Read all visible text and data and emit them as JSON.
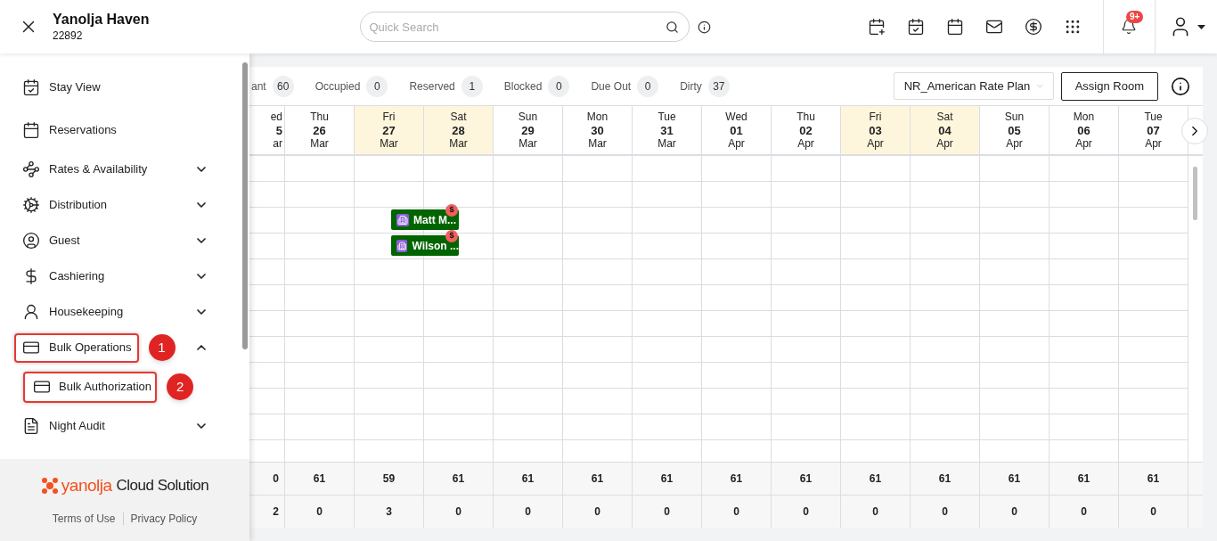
{
  "header": {
    "property_name": "Yanolja Haven",
    "property_id": "22892",
    "search": {
      "placeholder": "Quick Search"
    },
    "notification_badge": "9+"
  },
  "sidebar": {
    "items": [
      {
        "label": "Stay View",
        "kind": "link",
        "highlighted": false
      },
      {
        "label": "Reservations",
        "kind": "link",
        "highlighted": false
      },
      {
        "label": "Rates & Availability",
        "kind": "group",
        "expanded": false,
        "highlighted": false
      },
      {
        "label": "Distribution",
        "kind": "group",
        "expanded": false,
        "highlighted": false
      },
      {
        "label": "Guest",
        "kind": "group",
        "expanded": false,
        "highlighted": false
      },
      {
        "label": "Cashiering",
        "kind": "group",
        "expanded": false,
        "highlighted": false
      },
      {
        "label": "Housekeeping",
        "kind": "group",
        "expanded": false,
        "highlighted": false
      },
      {
        "label": "Bulk Operations",
        "kind": "group",
        "expanded": true,
        "highlighted": true,
        "callout": "1",
        "children": [
          {
            "label": "Bulk Authorization",
            "highlighted": true,
            "callout": "2"
          }
        ]
      },
      {
        "label": "Night Audit",
        "kind": "group",
        "expanded": false,
        "highlighted": false
      }
    ],
    "logo": {
      "brand": "yanolja",
      "product": "Cloud Solution"
    },
    "links": [
      "Terms of Use",
      "Privacy Policy"
    ]
  },
  "stats": [
    {
      "label": "ant",
      "count": "60"
    },
    {
      "label": "Occupied",
      "count": "0"
    },
    {
      "label": "Reserved",
      "count": "1"
    },
    {
      "label": "Blocked",
      "count": "0"
    },
    {
      "label": "Due Out",
      "count": "0"
    },
    {
      "label": "Dirty",
      "count": "37"
    }
  ],
  "rate_plan_select": {
    "value": "NR_American Rate Plan"
  },
  "assign_button": "Assign Room",
  "dates": [
    {
      "weekday": "ed",
      "day": "5",
      "month": "ar",
      "weekend": false
    },
    {
      "weekday": "Thu",
      "day": "26",
      "month": "Mar",
      "weekend": false
    },
    {
      "weekday": "Fri",
      "day": "27",
      "month": "Mar",
      "weekend": true
    },
    {
      "weekday": "Sat",
      "day": "28",
      "month": "Mar",
      "weekend": true
    },
    {
      "weekday": "Sun",
      "day": "29",
      "month": "Mar",
      "weekend": false
    },
    {
      "weekday": "Mon",
      "day": "30",
      "month": "Mar",
      "weekend": false
    },
    {
      "weekday": "Tue",
      "day": "31",
      "month": "Mar",
      "weekend": false
    },
    {
      "weekday": "Wed",
      "day": "01",
      "month": "Apr",
      "weekend": false
    },
    {
      "weekday": "Thu",
      "day": "02",
      "month": "Apr",
      "weekend": false
    },
    {
      "weekday": "Fri",
      "day": "03",
      "month": "Apr",
      "weekend": true
    },
    {
      "weekday": "Sat",
      "day": "04",
      "month": "Apr",
      "weekend": true
    },
    {
      "weekday": "Sun",
      "day": "05",
      "month": "Apr",
      "weekend": false
    },
    {
      "weekday": "Mon",
      "day": "06",
      "month": "Apr",
      "weekend": false
    },
    {
      "weekday": "Tue",
      "day": "07",
      "month": "Apr",
      "weekend": false
    }
  ],
  "bookings": [
    {
      "name": "Matt M...",
      "badge": "$"
    },
    {
      "name": "Wilson ...",
      "badge": "$"
    }
  ],
  "totals": [
    [
      "0",
      "61",
      "59",
      "61",
      "61",
      "61",
      "61",
      "61",
      "61",
      "61",
      "61",
      "61",
      "61",
      "61"
    ],
    [
      "2",
      "0",
      "3",
      "0",
      "0",
      "0",
      "0",
      "0",
      "0",
      "0",
      "0",
      "0",
      "0",
      "0"
    ]
  ]
}
